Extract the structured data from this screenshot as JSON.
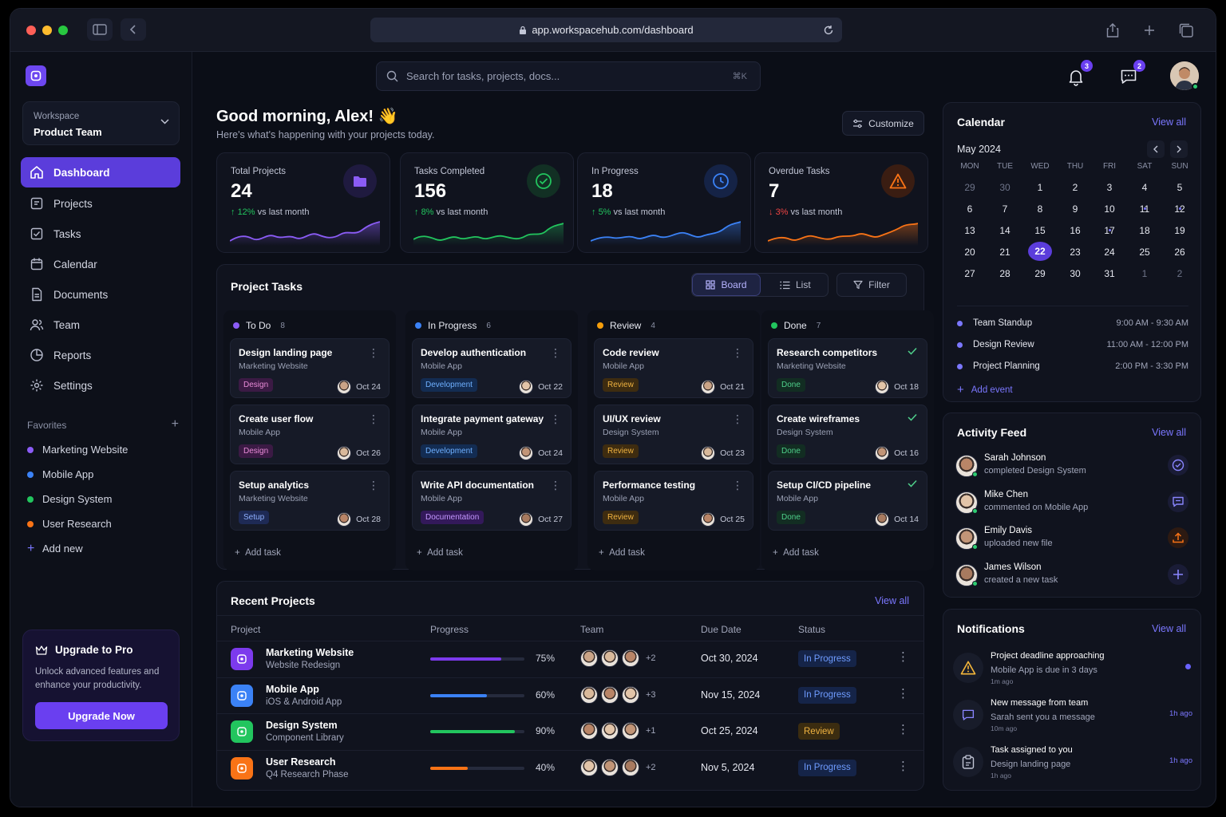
{
  "browser": {
    "url": "app.workspacehub.com/dashboard"
  },
  "sidebar": {
    "workspace_label": "Workspace",
    "workspace_name": "Product Team",
    "nav": [
      {
        "label": "Dashboard",
        "icon": "home-icon",
        "active": true
      },
      {
        "label": "Projects",
        "icon": "folder-icon"
      },
      {
        "label": "Tasks",
        "icon": "checkbox-icon"
      },
      {
        "label": "Calendar",
        "icon": "calendar-icon"
      },
      {
        "label": "Documents",
        "icon": "document-icon"
      },
      {
        "label": "Team",
        "icon": "users-icon"
      },
      {
        "label": "Reports",
        "icon": "chart-pie-icon"
      },
      {
        "label": "Settings",
        "icon": "gear-icon"
      }
    ],
    "favorites_label": "Favorites",
    "favorites": [
      {
        "label": "Marketing Website",
        "color": "#8b5cf6"
      },
      {
        "label": "Mobile App",
        "color": "#3b82f6"
      },
      {
        "label": "Design System",
        "color": "#22c55e"
      },
      {
        "label": "User Research",
        "color": "#f97316"
      }
    ],
    "add_new": "Add new",
    "upgrade": {
      "title": "Upgrade to Pro",
      "desc": "Unlock advanced features and enhance your productivity.",
      "button": "Upgrade Now"
    }
  },
  "header": {
    "search_placeholder": "Search for tasks, projects, docs...",
    "shortcut": "⌘K",
    "notifications_count": "3",
    "messages_count": "2"
  },
  "greeting": {
    "title": "Good morning, Alex! 👋",
    "subtitle": "Here's what's happening with your projects today.",
    "customize": "Customize"
  },
  "stats": [
    {
      "label": "Total Projects",
      "value": "24",
      "change": "12%",
      "suffix": "vs last month",
      "trend": "up",
      "color": "#8b5cf6"
    },
    {
      "label": "Tasks Completed",
      "value": "156",
      "change": "8%",
      "suffix": "vs last month",
      "trend": "up",
      "color": "#22c55e"
    },
    {
      "label": "In Progress",
      "value": "18",
      "change": "5%",
      "suffix": "vs last month",
      "trend": "up",
      "color": "#3b82f6"
    },
    {
      "label": "Overdue Tasks",
      "value": "7",
      "change": "3%",
      "suffix": "vs last month",
      "trend": "down",
      "color": "#f97316"
    }
  ],
  "tasks": {
    "title": "Project Tasks",
    "views": {
      "board": "Board",
      "list": "List",
      "filter": "Filter"
    },
    "add_task": "Add task",
    "columns": [
      {
        "name": "To Do",
        "count": "8",
        "color": "#8b5cf6",
        "cards": [
          {
            "title": "Design landing page",
            "project": "Marketing Website",
            "tag": "Design",
            "tagc": "tag-design",
            "date": "Oct 24"
          },
          {
            "title": "Create user flow",
            "project": "Mobile App",
            "tag": "Design",
            "tagc": "tag-design",
            "date": "Oct 26"
          },
          {
            "title": "Setup analytics",
            "project": "Marketing Website",
            "tag": "Setup",
            "tagc": "tag-setup",
            "date": "Oct 28"
          }
        ]
      },
      {
        "name": "In Progress",
        "count": "6",
        "color": "#3b82f6",
        "cards": [
          {
            "title": "Develop authentication",
            "project": "Mobile App",
            "tag": "Development",
            "tagc": "tag-dev",
            "date": "Oct 22"
          },
          {
            "title": "Integrate payment gateway",
            "project": "Mobile App",
            "tag": "Development",
            "tagc": "tag-dev",
            "date": "Oct 24"
          },
          {
            "title": "Write API documentation",
            "project": "Mobile App",
            "tag": "Documentation",
            "tagc": "tag-doc",
            "date": "Oct 27"
          }
        ]
      },
      {
        "name": "Review",
        "count": "4",
        "color": "#f59e0b",
        "cards": [
          {
            "title": "Code review",
            "project": "Mobile App",
            "tag": "Review",
            "tagc": "tag-review",
            "date": "Oct 21"
          },
          {
            "title": "UI/UX review",
            "project": "Design System",
            "tag": "Review",
            "tagc": "tag-review",
            "date": "Oct 23"
          },
          {
            "title": "Performance testing",
            "project": "Mobile App",
            "tag": "Review",
            "tagc": "tag-review",
            "date": "Oct 25"
          }
        ]
      },
      {
        "name": "Done",
        "count": "7",
        "color": "#22c55e",
        "cards": [
          {
            "title": "Research competitors",
            "project": "Marketing Website",
            "tag": "Done",
            "tagc": "tag-done",
            "date": "Oct 18"
          },
          {
            "title": "Create wireframes",
            "project": "Design System",
            "tag": "Done",
            "tagc": "tag-done",
            "date": "Oct 16"
          },
          {
            "title": "Setup CI/CD pipeline",
            "project": "Mobile App",
            "tag": "Done",
            "tagc": "tag-done",
            "date": "Oct 14"
          }
        ]
      }
    ]
  },
  "recent": {
    "title": "Recent Projects",
    "view_all": "View all",
    "headers": {
      "project": "Project",
      "progress": "Progress",
      "team": "Team",
      "due": "Due Date",
      "status": "Status"
    },
    "rows": [
      {
        "name": "Marketing Website",
        "sub": "Website Redesign",
        "progress": 75,
        "progress_label": "75%",
        "more": "+2",
        "due": "Oct 30, 2024",
        "status": "In Progress",
        "stc": "st-prog",
        "color": "#7c3aed"
      },
      {
        "name": "Mobile App",
        "sub": "iOS & Android App",
        "progress": 60,
        "progress_label": "60%",
        "more": "+3",
        "due": "Nov 15, 2024",
        "status": "In Progress",
        "stc": "st-prog",
        "color": "#3b82f6"
      },
      {
        "name": "Design System",
        "sub": "Component Library",
        "progress": 90,
        "progress_label": "90%",
        "more": "+1",
        "due": "Oct 25, 2024",
        "status": "Review",
        "stc": "st-rev",
        "color": "#22c55e"
      },
      {
        "name": "User Research",
        "sub": "Q4 Research Phase",
        "progress": 40,
        "progress_label": "40%",
        "more": "+2",
        "due": "Nov 5, 2024",
        "status": "In Progress",
        "stc": "st-prog",
        "color": "#f97316"
      }
    ]
  },
  "calendar": {
    "title": "Calendar",
    "view_all": "View all",
    "month": "May 2024",
    "dow": [
      "MON",
      "TUE",
      "WED",
      "THU",
      "FRI",
      "SAT",
      "SUN"
    ],
    "weeks": [
      [
        "29",
        "30",
        "1",
        "2",
        "3",
        "4",
        "5"
      ],
      [
        "6",
        "7",
        "8",
        "9",
        "10",
        "11",
        "12"
      ],
      [
        "13",
        "14",
        "15",
        "16",
        "17",
        "18",
        "19"
      ],
      [
        "20",
        "21",
        "22",
        "23",
        "24",
        "25",
        "26"
      ],
      [
        "27",
        "28",
        "29",
        "30",
        "31",
        "1",
        "2"
      ]
    ],
    "today": "22",
    "events": [
      {
        "name": "Team Standup",
        "time": "9:00 AM - 9:30 AM"
      },
      {
        "name": "Design Review",
        "time": "11:00 AM - 12:00 PM"
      },
      {
        "name": "Project Planning",
        "time": "2:00 PM - 3:30 PM"
      }
    ],
    "add_event": "Add event"
  },
  "activity": {
    "title": "Activity Feed",
    "view_all": "View all",
    "items": [
      {
        "name": "Sarah Johnson",
        "desc": "completed Design System",
        "icon": "check-circle-icon",
        "color": "#7b77ff"
      },
      {
        "name": "Mike Chen",
        "desc": "commented on Mobile App",
        "icon": "comment-icon",
        "color": "#7b77ff"
      },
      {
        "name": "Emily Davis",
        "desc": "uploaded new file",
        "icon": "upload-icon",
        "color": "#f97316"
      },
      {
        "name": "James Wilson",
        "desc": "created a new task",
        "icon": "plus-icon",
        "color": "#7b77ff"
      }
    ]
  },
  "notifications": {
    "title": "Notifications",
    "view_all": "View all",
    "items": [
      {
        "title": "Project deadline approaching",
        "desc": "Mobile App is due in 3 days",
        "time": "1m ago",
        "ago": ""
      },
      {
        "title": "New message from team",
        "desc": "Sarah sent you a message",
        "time": "10m ago",
        "ago": "1h ago"
      },
      {
        "title": "Task assigned to you",
        "desc": "Design landing page",
        "time": "1h ago",
        "ago": "1h ago"
      }
    ]
  }
}
